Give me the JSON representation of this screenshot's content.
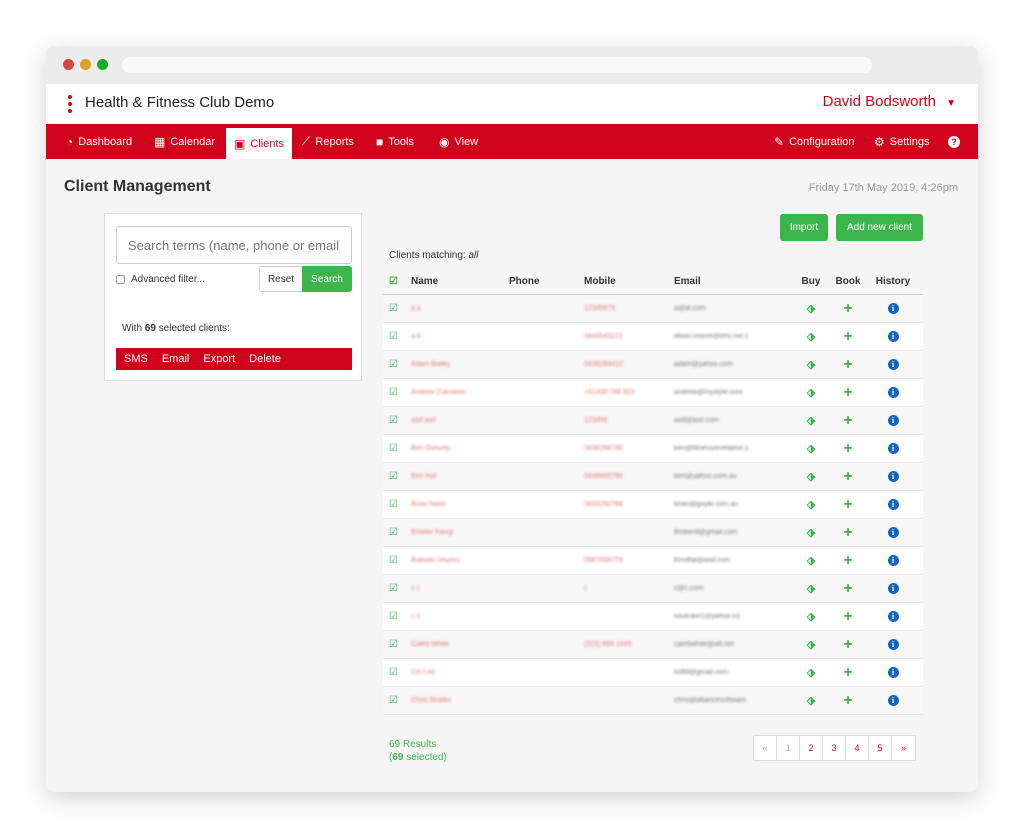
{
  "app": {
    "title": "Health & Fitness Club Demo",
    "user": "David Bodsworth"
  },
  "nav": {
    "left": [
      {
        "label": "Dashboard",
        "icon": "dashboard-icon"
      },
      {
        "label": "Calendar",
        "icon": "calendar-icon"
      },
      {
        "label": "Clients",
        "icon": "id-card-icon",
        "active": true
      },
      {
        "label": "Reports",
        "icon": "chart-line-icon"
      },
      {
        "label": "Tools",
        "icon": "toolbox-icon"
      },
      {
        "label": "View",
        "icon": "eye-icon"
      }
    ],
    "right": [
      {
        "label": "Configuration",
        "icon": "wrench-icon"
      },
      {
        "label": "Settings",
        "icon": "gear-icon"
      },
      {
        "label": "",
        "icon": "help-icon"
      }
    ]
  },
  "page": {
    "title": "Client Management",
    "datetime": "Friday 17th May 2019, 4:26pm"
  },
  "search": {
    "placeholder": "Search terms (name, phone or email)",
    "advanced_label": "Advanced filter...",
    "reset_label": "Reset",
    "search_label": "Search",
    "selected_prefix": "With ",
    "selected_count": "69",
    "selected_suffix": " selected clients:",
    "actions": [
      "SMS",
      "Email",
      "Export",
      "Delete"
    ]
  },
  "toolbar": {
    "import_label": "Import",
    "add_label": "Add new client"
  },
  "table": {
    "matching_prefix": "Clients matching: ",
    "matching_value": "all",
    "headers": {
      "name": "Name",
      "phone": "Phone",
      "mobile": "Mobile",
      "email": "Email",
      "buy": "Buy",
      "book": "Book",
      "history": "History"
    },
    "rows": [
      {
        "name": "a a",
        "phone": "",
        "mobile": "12345678",
        "email": "a@at.com"
      },
      {
        "name": "a b",
        "phone": "",
        "mobile": "0444543221",
        "email": "deion.moore@ehc.net.c"
      },
      {
        "name": "Adam Bailey",
        "phone": "",
        "mobile": "0438284410",
        "email": "adam@yahoo.com"
      },
      {
        "name": "Andrew Zukowski",
        "phone": "",
        "mobile": "+61439 788 923",
        "email": "andrew@mystyle.com"
      },
      {
        "name": "asd asd",
        "phone": "",
        "mobile": "123456",
        "email": "asd@asd.com"
      },
      {
        "name": "Ben Duhurty",
        "phone": "",
        "mobile": "0438268780",
        "email": "ben@fitnessrevelation.c"
      },
      {
        "name": "Ben Hat",
        "phone": "",
        "mobile": "0448665780",
        "email": "ben@yahoo.com.au"
      },
      {
        "name": "Brian Nash",
        "phone": "",
        "mobile": "0433292788",
        "email": "brian@gnyle.com.au"
      },
      {
        "name": "Brooke Rangi",
        "phone": "",
        "mobile": "",
        "email": "Brokerd@gmail.com"
      },
      {
        "name": "Bubudu Unumu",
        "phone": "",
        "mobile": "0987658778",
        "email": "lfmoffat@asd.com"
      },
      {
        "name": "c c",
        "phone": "",
        "mobile": "c",
        "email": "c@c.com"
      },
      {
        "name": "c s",
        "phone": "",
        "mobile": "",
        "email": "soulcare1@yahoo.co"
      },
      {
        "name": "Caleb White",
        "phone": "",
        "mobile": "(323) 665 1449",
        "email": "calebwhite@att.net"
      },
      {
        "name": "Chi Lee",
        "phone": "",
        "mobile": "",
        "email": "fsdfd@gmail.com"
      },
      {
        "name": "Chris Stubbs",
        "phone": "",
        "mobile": "",
        "email": "chris@alliancesoftware."
      }
    ]
  },
  "footer": {
    "results_label": "69 Results",
    "selected_open": "(",
    "selected_count": "69",
    "selected_close": " selected)",
    "pages": [
      "«",
      "1",
      "2",
      "3",
      "4",
      "5",
      "»"
    ]
  },
  "colors": {
    "brand": "#d0021b",
    "success": "#3cb54a",
    "info": "#1565c0"
  }
}
